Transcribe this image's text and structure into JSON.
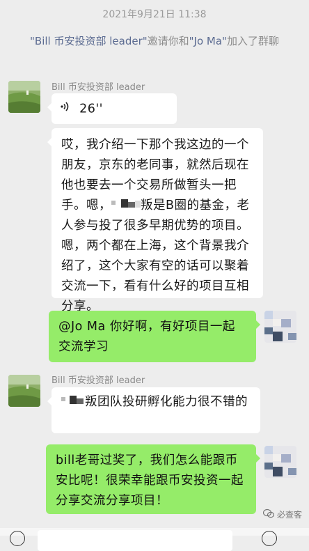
{
  "timestamp": "2021年9月21日 11:38",
  "notice": {
    "inviter": "\"Bill 币安投资部 leader\"",
    "text1": "邀请你和",
    "invitee": "\"Jo Ma\"",
    "text2": "加入了群聊"
  },
  "messages": [
    {
      "sender": "Bill 币安投资部 leader",
      "voice_duration": "26''"
    },
    {
      "line1": "哎，我介绍一下那个我这边的一个朋友，京东的老同事，就然后现在他也要去一个交易所做暂头一把手。嗯，",
      "line2": "叛是B圈的基金，老人参与投了很多早期优势的项目。嗯，两个都在上海，这个背景我介绍了，这个大家有空的话可以聚着交流一下，看有什么好的项目互相分享。"
    },
    {
      "text": "@Jo Ma 你好啊，有好项目一起交流学习"
    },
    {
      "sender": "Bill 币安投资部 leader",
      "text": "叛团队投研孵化能力很不错的"
    },
    {
      "text": "bill老哥过奖了，我们怎么能跟币安比呢！很荣幸能跟币安投资一起分享交流分享项目！"
    }
  ],
  "watermark": "必查客",
  "colors": {
    "green_bubble": "#95ec69",
    "white_bubble": "#ffffff",
    "background": "#ededed"
  }
}
